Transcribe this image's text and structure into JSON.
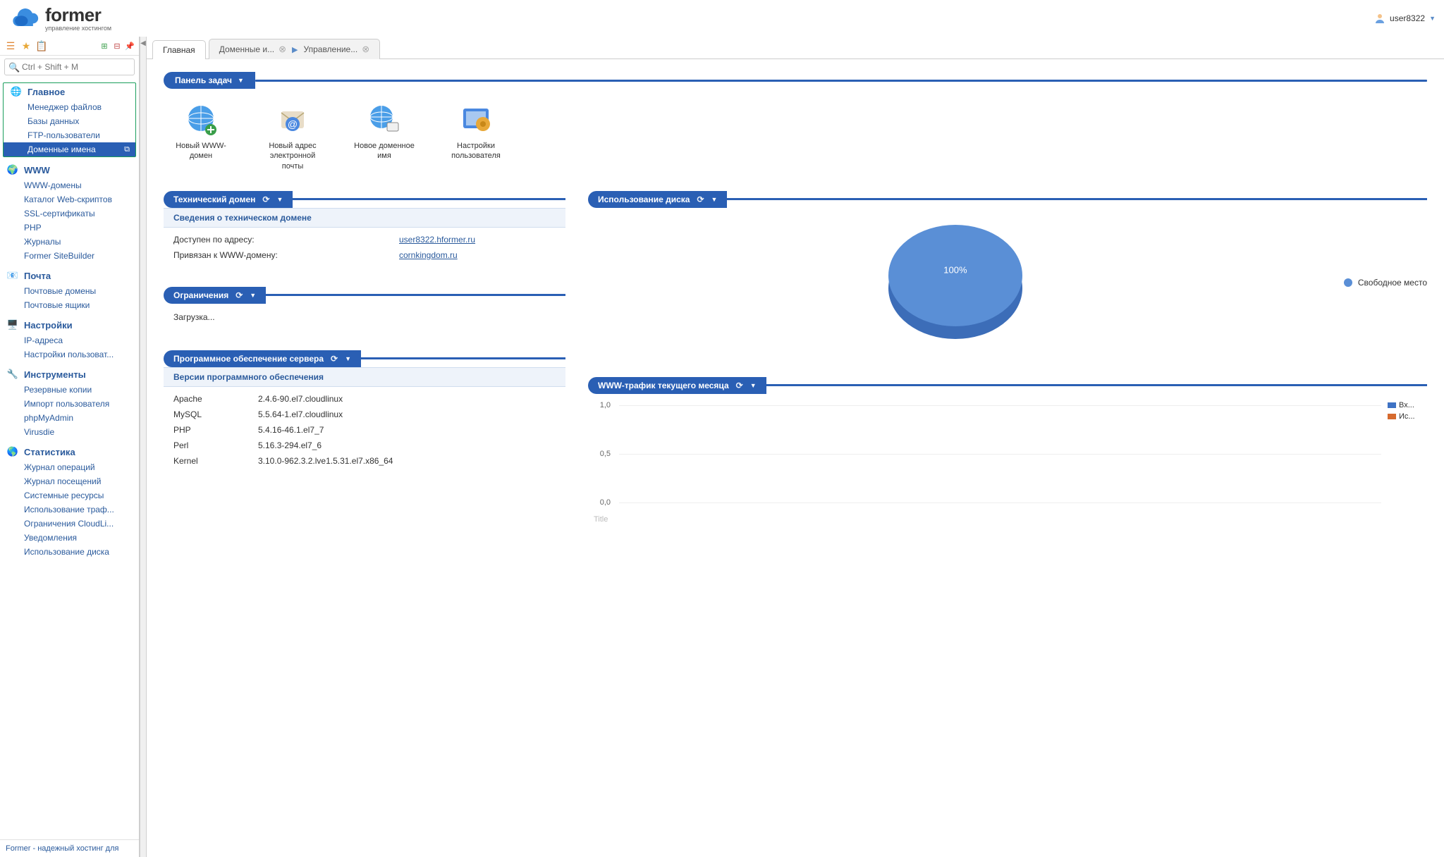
{
  "brand": {
    "name": "former",
    "tagline": "управление хостингом"
  },
  "user": {
    "name": "user8322"
  },
  "sidebar": {
    "search_placeholder": "Ctrl + Shift + M",
    "groups": [
      {
        "title": "Главное",
        "highlighted": true,
        "icon": "globe",
        "items": [
          {
            "label": "Менеджер файлов"
          },
          {
            "label": "Базы данных"
          },
          {
            "label": "FTP-пользователи"
          },
          {
            "label": "Доменные имена",
            "active": true
          }
        ]
      },
      {
        "title": "WWW",
        "icon": "www",
        "items": [
          {
            "label": "WWW-домены"
          },
          {
            "label": "Каталог Web-скриптов"
          },
          {
            "label": "SSL-сертификаты"
          },
          {
            "label": "PHP"
          },
          {
            "label": "Журналы"
          },
          {
            "label": "Former SiteBuilder"
          }
        ]
      },
      {
        "title": "Почта",
        "icon": "mail",
        "items": [
          {
            "label": "Почтовые домены"
          },
          {
            "label": "Почтовые ящики"
          }
        ]
      },
      {
        "title": "Настройки",
        "icon": "settings",
        "items": [
          {
            "label": "IP-адреса"
          },
          {
            "label": "Настройки пользоват..."
          }
        ]
      },
      {
        "title": "Инструменты",
        "icon": "tools",
        "items": [
          {
            "label": "Резервные копии"
          },
          {
            "label": "Импорт пользователя"
          },
          {
            "label": "phpMyAdmin"
          },
          {
            "label": "Virusdie"
          }
        ]
      },
      {
        "title": "Статистика",
        "icon": "stats",
        "items": [
          {
            "label": "Журнал операций"
          },
          {
            "label": "Журнал посещений"
          },
          {
            "label": "Системные ресурсы"
          },
          {
            "label": "Использование траф..."
          },
          {
            "label": "Ограничения CloudLi..."
          },
          {
            "label": "Уведомления"
          },
          {
            "label": "Использование диска"
          }
        ]
      }
    ],
    "footer": "Former - надежный хостинг для"
  },
  "tabs": [
    {
      "label": "Главная",
      "active": true,
      "closable": false
    },
    {
      "crumbs": [
        "Доменные и...",
        "Управление..."
      ],
      "closable": true
    }
  ],
  "taskpanel": {
    "title": "Панель задач"
  },
  "quick_actions": [
    {
      "label": "Новый WWW-домен",
      "icon": "globe-plus"
    },
    {
      "label": "Новый адрес электронной почты",
      "icon": "mail-plus"
    },
    {
      "label": "Новое доменное имя",
      "icon": "domain-plus"
    },
    {
      "label": "Настройки пользователя",
      "icon": "user-settings"
    }
  ],
  "tech_domain": {
    "title": "Технический домен",
    "subtitle": "Сведения о техническом домене",
    "rows": [
      {
        "k": "Доступен по адресу:",
        "v": "user8322.hformer.ru"
      },
      {
        "k": "Привязан к WWW-домену:",
        "v": "cornkingdom.ru"
      }
    ]
  },
  "limits": {
    "title": "Ограничения",
    "loading": "Загрузка..."
  },
  "software": {
    "title": "Программное обеспечение сервера",
    "subtitle": "Версии программного обеспечения",
    "rows": [
      {
        "k": "Apache",
        "v": "2.4.6-90.el7.cloudlinux"
      },
      {
        "k": "MySQL",
        "v": "5.5.64-1.el7.cloudlinux"
      },
      {
        "k": "PHP",
        "v": "5.4.16-46.1.el7_7"
      },
      {
        "k": "Perl",
        "v": "5.16.3-294.el7_6"
      },
      {
        "k": "Kernel",
        "v": "3.10.0-962.3.2.lve1.5.31.el7.x86_64"
      }
    ]
  },
  "disk": {
    "title": "Использование диска",
    "legend": "Свободное место",
    "percent": "100%"
  },
  "traffic": {
    "title": "WWW-трафик текущего месяца",
    "y_ticks": [
      "1,0",
      "0,5",
      "0,0"
    ],
    "legend": [
      {
        "label": "Вх...",
        "color": "#3e72c4"
      },
      {
        "label": "Ис...",
        "color": "#d66a2e"
      }
    ],
    "footer": "Title"
  },
  "chart_data": [
    {
      "type": "pie",
      "title": "Использование диска",
      "series": [
        {
          "name": "Свободное место",
          "values": [
            100
          ]
        }
      ],
      "categories": [
        "Свободное место"
      ],
      "values": [
        100
      ],
      "unit": "%"
    },
    {
      "type": "line",
      "title": "WWW-трафик текущего месяца",
      "ylabel": "",
      "ylim": [
        0,
        1
      ],
      "y_ticks": [
        0.0,
        0.5,
        1.0
      ],
      "x": [],
      "series": [
        {
          "name": "Вх...",
          "color": "#3e72c4",
          "values": []
        },
        {
          "name": "Ис...",
          "color": "#d66a2e",
          "values": []
        }
      ]
    }
  ]
}
